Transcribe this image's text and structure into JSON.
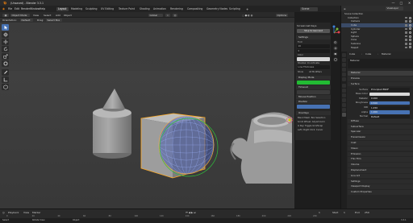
{
  "window": {
    "title": "(Unsaved) - Blender 3.3.1",
    "controls": [
      "—",
      "□",
      "✕"
    ]
  },
  "menubar": {
    "menus": [
      "File",
      "Edit",
      "Render",
      "Window",
      "Help"
    ],
    "workspaces": [
      "Layout",
      "Modeling",
      "Sculpting",
      "UV Editing",
      "Texture Paint",
      "Shading",
      "Animation",
      "Rendering",
      "Compositing",
      "Geometry Nodes",
      "Scripting"
    ],
    "active_workspace": "Layout",
    "scene_label": "Scene",
    "view_layer_label": "ViewLayer"
  },
  "viewport_header": {
    "mode": "Object Mode",
    "menus": [
      "View",
      "Select",
      "Add",
      "Object"
    ],
    "orientation_label": "Orientation:",
    "orientation_value": "Default",
    "drag_label": "Drag:",
    "drag_value": "Select Box",
    "transform_pivot": "Global",
    "options_label": "Options"
  },
  "screencast_panel": {
    "header": "Screencast Keys",
    "stop_button": "Stop Screencast",
    "settings_heading": "Settings",
    "font_label": "Font",
    "font_value": "16",
    "margin_value": "0",
    "color_label": "Color",
    "shadow_label": "Shadow: On Activate",
    "line_thickness_label": "Line Thickness",
    "show_label": "Show",
    "show_value": "All Modifiers",
    "display_mode_heading": "Display Mode",
    "progress_color": "#22bb33",
    "timeout_heading": "Timeout",
    "mouse_heading": "Mouse Position",
    "position_heading": "Position",
    "overlays_heading": "Overlays",
    "overlay_items": [
      "Blend Mesh: Box Selection",
      "Scroll Wheel: Adjust zoom",
      "G Key: Toggle Grid/Snap",
      "Left / Right Click: Cursor"
    ]
  },
  "outliner": {
    "header": "Scene Collection",
    "rows": [
      {
        "label": "Collection",
        "indent": 1,
        "selected": false
      },
      {
        "label": "Camera",
        "indent": 2,
        "selected": false
      },
      {
        "label": "Cube",
        "indent": 2,
        "selected": true
      },
      {
        "label": "Cylinder",
        "indent": 2,
        "selected": false
      },
      {
        "label": "Light",
        "indent": 2,
        "selected": false
      },
      {
        "label": "Sphere",
        "indent": 2,
        "selected": false
      },
      {
        "label": "Cone",
        "indent": 2,
        "selected": false
      },
      {
        "label": "Suzanne",
        "indent": 2,
        "selected": false
      },
      {
        "label": "Teapot",
        "indent": 2,
        "selected": false
      }
    ]
  },
  "properties": {
    "breadcrumb": [
      "Cube",
      "Cube",
      "Material"
    ],
    "material_slot": "Material",
    "rows": [
      {
        "type": "section",
        "label": "Preview"
      },
      {
        "type": "section",
        "label": "Surface"
      },
      {
        "type": "field",
        "key": "Surface",
        "value": "Principled BSDF",
        "style": "dark"
      },
      {
        "type": "field",
        "key": "Base Color",
        "value": "",
        "style": "light"
      },
      {
        "type": "field",
        "key": "Metallic",
        "value": "0.000",
        "style": "dark"
      },
      {
        "type": "field",
        "key": "Roughness",
        "value": "0.500",
        "style": "blue"
      },
      {
        "type": "field",
        "key": "IOR",
        "value": "1.450",
        "style": "dark"
      },
      {
        "type": "field",
        "key": "Alpha",
        "value": "1.000",
        "style": "blue"
      },
      {
        "type": "field",
        "key": "Normal",
        "value": "Default",
        "style": "dark"
      },
      {
        "type": "section",
        "label": "Diffuse"
      },
      {
        "type": "section",
        "label": "Subsurface"
      },
      {
        "type": "section",
        "label": "Specular"
      },
      {
        "type": "section",
        "label": "Transmission"
      },
      {
        "type": "section",
        "label": "Coat"
      },
      {
        "type": "section",
        "label": "Sheen"
      },
      {
        "type": "section",
        "label": "Emission"
      },
      {
        "type": "section",
        "label": "Thin Film"
      },
      {
        "type": "section",
        "label": "Volume"
      },
      {
        "type": "section",
        "label": "Displacement"
      },
      {
        "type": "section",
        "label": "Line Art"
      },
      {
        "type": "section",
        "label": "Settings"
      },
      {
        "type": "section",
        "label": "Viewport Display"
      },
      {
        "type": "section",
        "label": "Custom Properties"
      }
    ]
  },
  "timeline": {
    "menus": [
      "View",
      "Marker"
    ],
    "playback": "Playback",
    "start_label": "Start",
    "start_value": "1",
    "end_label": "End",
    "end_value": "250",
    "current_frame": "1",
    "ticks": [
      "0",
      "20",
      "40",
      "60",
      "80",
      "100",
      "120",
      "140",
      "160",
      "180",
      "200",
      "220",
      "240"
    ]
  },
  "statusbar": {
    "items": [
      "Select",
      "Rotate View",
      "Object",
      "3.3.1"
    ]
  },
  "colors": {
    "accent": "#4772b3",
    "gizmo_x": "#e0434f",
    "gizmo_y": "#76b33b",
    "gizmo_z": "#3e82d9",
    "selection_outline": "#ffaa22",
    "brush_circle": "#2ec23b"
  }
}
